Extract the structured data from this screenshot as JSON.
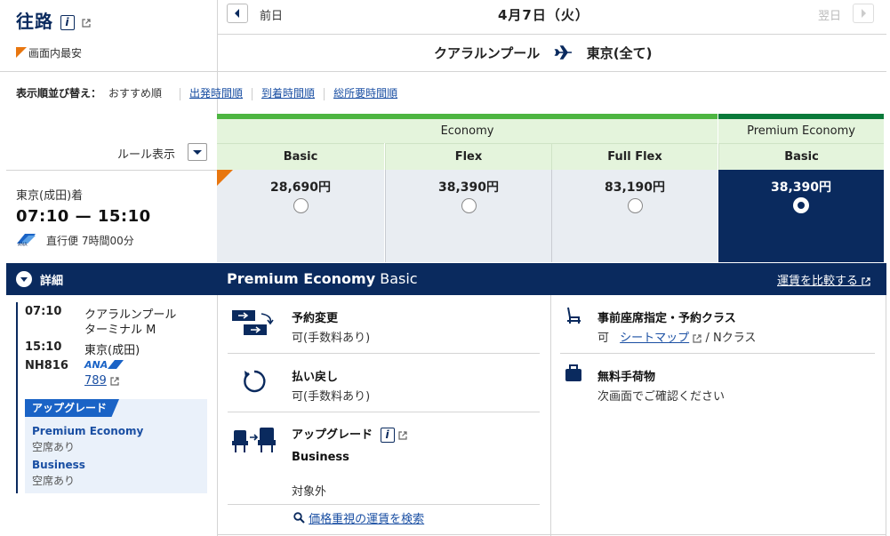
{
  "header": {
    "title": "往路",
    "lowest_label": "画面内最安",
    "prev_label": "前日",
    "date": "4月7日（火）",
    "next_label": "翌日",
    "origin": "クアラルンプール",
    "destination": "東京(全て)"
  },
  "sort": {
    "label": "表示順並び替え：",
    "current": "おすすめ順",
    "options": [
      "出発時間順",
      "到着時間順",
      "総所要時間順"
    ]
  },
  "fare_table": {
    "economy_label": "Economy",
    "premium_label": "Premium Economy",
    "rule_label": "ルール表示",
    "columns": [
      {
        "name": "Basic",
        "price": "28,690円",
        "selected": false
      },
      {
        "name": "Flex",
        "price": "38,390円",
        "selected": false
      },
      {
        "name": "Full Flex",
        "price": "83,190円",
        "selected": false
      },
      {
        "name": "Basic",
        "price": "38,390円",
        "selected": true
      }
    ]
  },
  "flight": {
    "arrival_airport": "東京(成田)着",
    "times": "07:10 — 15:10",
    "duration": "直行便 7時間00分"
  },
  "details": {
    "toggle_label": "詳細",
    "fare_title_bold": "Premium Economy",
    "fare_title_rest": " Basic",
    "compare_label": "運賃を比較する",
    "change_label": "予約変更",
    "change_value": "可(手数料あり)",
    "refund_label": "払い戻し",
    "refund_value": "可(手数料あり)",
    "upgrade_label": "アップグレード",
    "upgrade_class": "Business",
    "upgrade_value": "対象外",
    "search_link": "価格重視の運賃を検索",
    "seat_label": "事前座席指定・予約クラス",
    "seat_value_prefix": "可",
    "seat_map_link": "シートマップ",
    "seat_value_suffix": "/ Nクラス",
    "baggage_label": "無料手荷物",
    "baggage_value": "次画面でご確認ください"
  },
  "itinerary": {
    "dep_time": "07:10",
    "dep_airport": "クアラルンプール",
    "dep_terminal": "ターミナル M",
    "arr_time": "15:10",
    "arr_airport": "東京(成田)",
    "flight_no": "NH816",
    "airline_logo": "ANA",
    "aircraft": "789",
    "upgrade_tag": "アップグレード",
    "upgrades": [
      {
        "class": "Premium Economy",
        "status": "空席あり"
      },
      {
        "class": "Business",
        "status": "空席あり"
      }
    ]
  },
  "colors": {
    "navy": "#0a2a5e",
    "green": "#4db541",
    "dark_green": "#0a7a3a",
    "orange": "#e8760f",
    "link": "#1a4fa3"
  }
}
